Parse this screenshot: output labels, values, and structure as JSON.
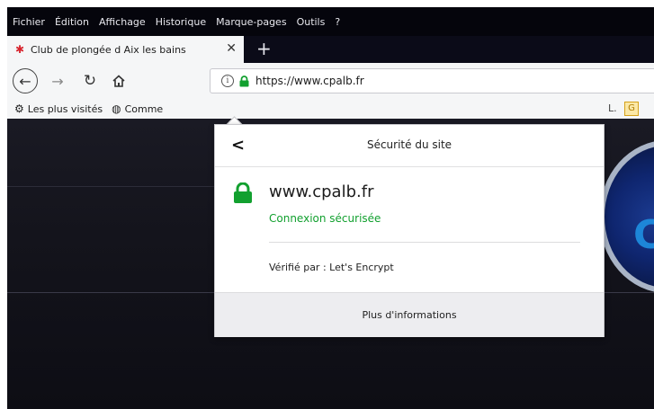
{
  "menu": [
    "Fichier",
    "Édition",
    "Affichage",
    "Historique",
    "Marque-pages",
    "Outils",
    "?"
  ],
  "tab": {
    "title": "Club de plongée d Aix les bains",
    "close": "✕",
    "new_tab": "+"
  },
  "url": "https://www.cpalb.fr",
  "bookmarks": {
    "most_visited": "Les plus visités",
    "second": "Comme"
  },
  "popup": {
    "back": "<",
    "title": "Sécurité du site",
    "domain": "www.cpalb.fr",
    "status": "Connexion sécurisée",
    "verified_by": "Vérifié par : Let's Encrypt",
    "more_info": "Plus d'informations"
  },
  "colors": {
    "secure_green": "#12a02f",
    "menu_bg": "#05050c"
  },
  "icons": [
    "back-arrow-icon",
    "forward-arrow-icon",
    "reload-icon",
    "home-icon",
    "info-icon",
    "lock-icon",
    "gear-icon",
    "globe-icon",
    "favicon-icon"
  ]
}
